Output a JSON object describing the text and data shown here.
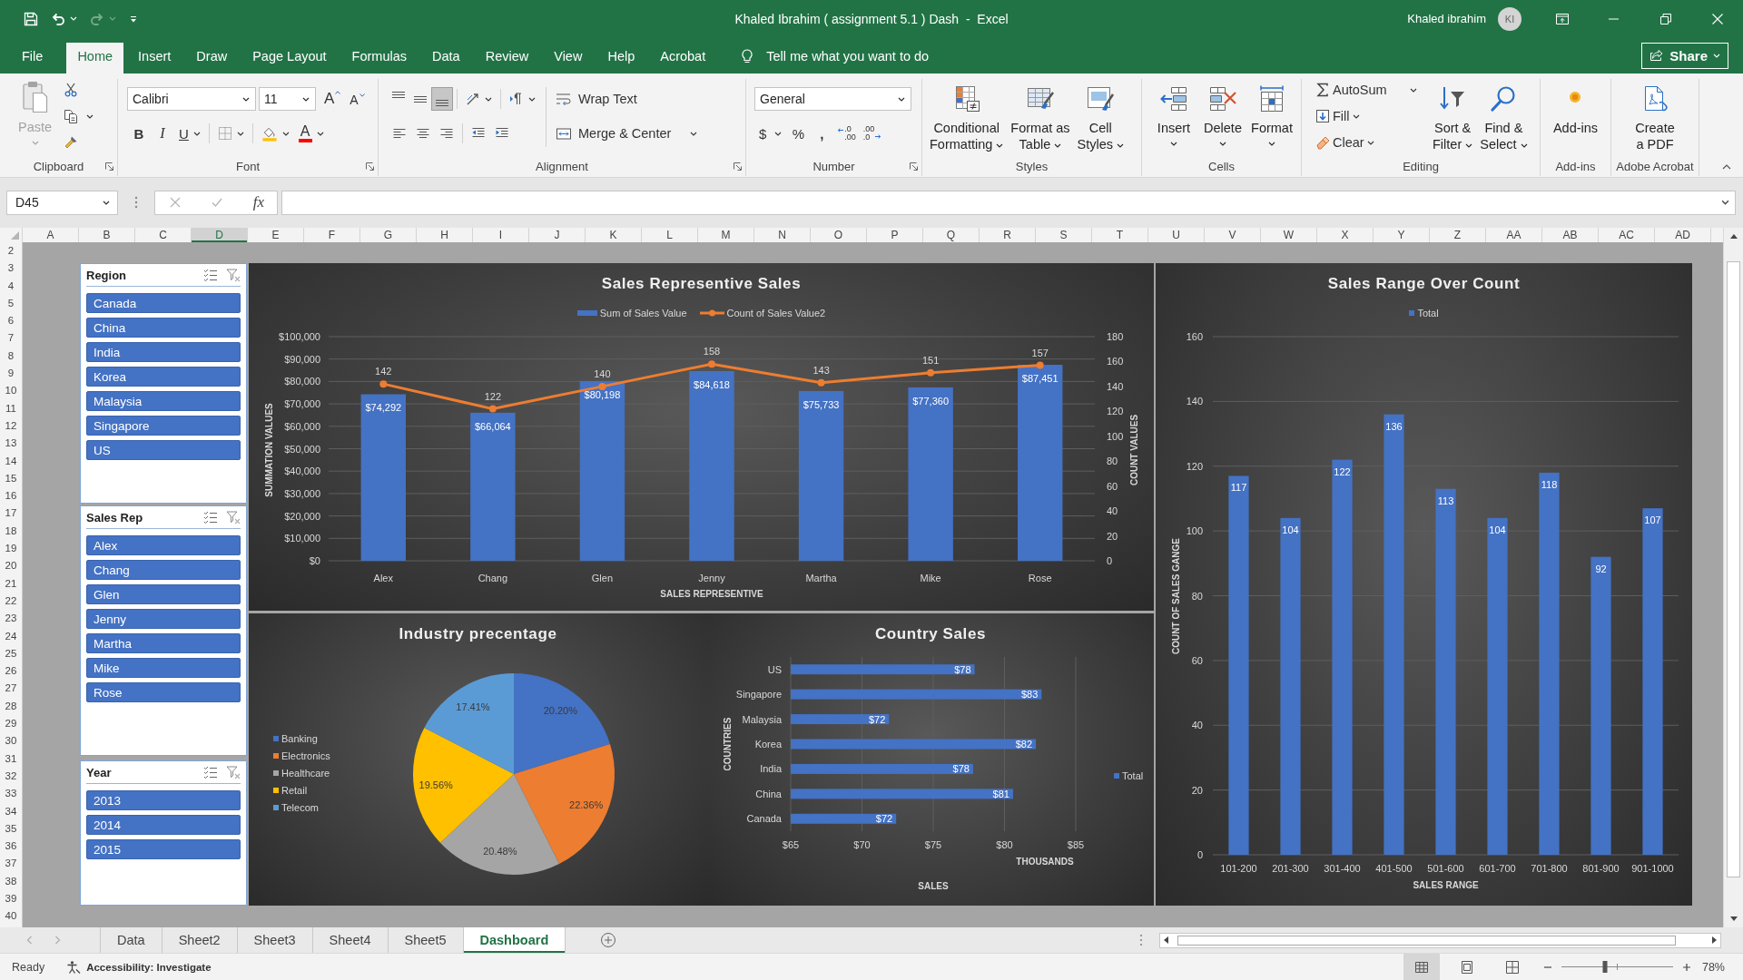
{
  "title_bar": {
    "title": "Khaled Ibrahim ( assignment 5.1 ) Dash  -  Excel",
    "user": "Khaled ibrahim",
    "initials": "KI",
    "redo_disabled": true
  },
  "menu_tabs": [
    {
      "label": "File",
      "selected": false
    },
    {
      "label": "Home",
      "selected": true
    },
    {
      "label": "Insert",
      "selected": false
    },
    {
      "label": "Draw",
      "selected": false
    },
    {
      "label": "Page Layout",
      "selected": false
    },
    {
      "label": "Formulas",
      "selected": false
    },
    {
      "label": "Data",
      "selected": false
    },
    {
      "label": "Review",
      "selected": false
    },
    {
      "label": "View",
      "selected": false
    },
    {
      "label": "Help",
      "selected": false
    },
    {
      "label": "Acrobat",
      "selected": false
    }
  ],
  "tell_me": "Tell me what you want to do",
  "share": "Share",
  "ribbon": {
    "clipboard": {
      "label": "Clipboard",
      "paste": "Paste",
      "paste_disabled": true
    },
    "font": {
      "label": "Font",
      "family": "Calibri",
      "size": "11",
      "grow": "A",
      "shrink": "A",
      "bold": "B",
      "italic": "I",
      "underline": "U",
      "color_letter": "A"
    },
    "alignment": {
      "label": "Alignment",
      "vertical": [
        {
          "kind": "top",
          "selected": false
        },
        {
          "kind": "middle",
          "selected": false
        },
        {
          "kind": "bottom",
          "selected": true
        }
      ],
      "wrap_text": "Wrap Text",
      "merge": "Merge & Center"
    },
    "number": {
      "label": "Number",
      "format": "General",
      "currency": "$",
      "percent": "%",
      "comma": ",",
      "increase_decimal": ".0\n.00",
      "decrease_decimal": ".00\n.0"
    },
    "styles": {
      "label": "Styles",
      "buttons": [
        {
          "kind": "conditional",
          "label": "Conditional\nFormatting"
        },
        {
          "kind": "table",
          "label": "Format as\nTable"
        },
        {
          "kind": "cell_styles",
          "label": "Cell\nStyles"
        }
      ]
    },
    "cells": {
      "label": "Cells",
      "buttons": [
        {
          "kind": "insert",
          "label": "Insert"
        },
        {
          "kind": "delete",
          "label": "Delete"
        },
        {
          "kind": "format",
          "label": "Format"
        }
      ]
    },
    "editing": {
      "label": "Editing",
      "autosum": "AutoSum",
      "fill": "Fill",
      "clear": "Clear",
      "sort": "Sort &\nFilter",
      "find": "Find &\nSelect"
    },
    "addins": {
      "label": "Add-ins",
      "button": "Add-ins"
    },
    "acrobat": {
      "label": "Adobe Acrobat",
      "button": "Create\na PDF"
    }
  },
  "formula_bar": {
    "name_box": "D45",
    "fx": "fx",
    "editing": false
  },
  "columns": [
    {
      "label": "A",
      "selected": false
    },
    {
      "label": "B",
      "selected": false
    },
    {
      "label": "C",
      "selected": false
    },
    {
      "label": "D",
      "selected": true
    },
    {
      "label": "E",
      "selected": false
    },
    {
      "label": "F",
      "selected": false
    },
    {
      "label": "G",
      "selected": false
    },
    {
      "label": "H",
      "selected": false
    },
    {
      "label": "I",
      "selected": false
    },
    {
      "label": "J",
      "selected": false
    },
    {
      "label": "K",
      "selected": false
    },
    {
      "label": "L",
      "selected": false
    },
    {
      "label": "M",
      "selected": false
    },
    {
      "label": "N",
      "selected": false
    },
    {
      "label": "O",
      "selected": false
    },
    {
      "label": "P",
      "selected": false
    },
    {
      "label": "Q",
      "selected": false
    },
    {
      "label": "R",
      "selected": false
    },
    {
      "label": "S",
      "selected": false
    },
    {
      "label": "T",
      "selected": false
    },
    {
      "label": "U",
      "selected": false
    },
    {
      "label": "V",
      "selected": false
    },
    {
      "label": "W",
      "selected": false
    },
    {
      "label": "X",
      "selected": false
    },
    {
      "label": "Y",
      "selected": false
    },
    {
      "label": "Z",
      "selected": false
    },
    {
      "label": "AA",
      "selected": false
    },
    {
      "label": "AB",
      "selected": false
    },
    {
      "label": "AC",
      "selected": false
    },
    {
      "label": "AD",
      "selected": false
    }
  ],
  "rows": [
    "2",
    "3",
    "4",
    "5",
    "6",
    "7",
    "8",
    "9",
    "10",
    "11",
    "12",
    "13",
    "14",
    "15",
    "16",
    "17",
    "18",
    "19",
    "20",
    "21",
    "22",
    "23",
    "24",
    "25",
    "26",
    "27",
    "28",
    "29",
    "30",
    "31",
    "32",
    "33",
    "34",
    "35",
    "36",
    "37",
    "38",
    "39",
    "40"
  ],
  "dashboard": {
    "slicers": [
      {
        "title": "Region",
        "filtered": false,
        "items": [
          {
            "label": "Canada",
            "selected": true
          },
          {
            "label": "China",
            "selected": true
          },
          {
            "label": "India",
            "selected": true
          },
          {
            "label": "Korea",
            "selected": true
          },
          {
            "label": "Malaysia",
            "selected": true
          },
          {
            "label": "Singapore",
            "selected": true
          },
          {
            "label": "US",
            "selected": true
          }
        ]
      },
      {
        "title": "Sales Rep",
        "filtered": false,
        "items": [
          {
            "label": "Alex",
            "selected": true
          },
          {
            "label": "Chang",
            "selected": true
          },
          {
            "label": "Glen",
            "selected": true
          },
          {
            "label": "Jenny",
            "selected": true
          },
          {
            "label": "Martha",
            "selected": true
          },
          {
            "label": "Mike",
            "selected": true
          },
          {
            "label": "Rose",
            "selected": true
          }
        ]
      },
      {
        "title": "Year",
        "filtered": false,
        "items": [
          {
            "label": "2013",
            "selected": true
          },
          {
            "label": "2014",
            "selected": true
          },
          {
            "label": "2015",
            "selected": true
          }
        ]
      }
    ],
    "charts": [
      {
        "chart_data": [
          {
            "type": "bar",
            "title": "Sales Representive Sales",
            "xlabel": "SALES REPRESENTIVE",
            "ylabel": "SUMMATION VALUES",
            "y2label": "COUNT VALUES",
            "legend": "top",
            "grid": true,
            "data_labels": true,
            "categories": [
              "Alex",
              "Chang",
              "Glen",
              "Jenny",
              "Martha",
              "Mike",
              "Rose"
            ],
            "series": [
              {
                "name": "Sum of Sales Value",
                "type": "bar",
                "color": "#4472c4",
                "values": [
                  74292,
                  66064,
                  80198,
                  84618,
                  75733,
                  77360,
                  87451
                ],
                "value_labels": [
                  "$74,292",
                  "$66,064",
                  "$80,198",
                  "$84,618",
                  "$75,733",
                  "$77,360",
                  "$87,451"
                ]
              },
              {
                "name": "Count of Sales Value2",
                "type": "line",
                "axis": "y2",
                "marker": "circle",
                "color": "#ed7d31",
                "values": [
                  142,
                  122,
                  140,
                  158,
                  143,
                  151,
                  157
                ],
                "value_labels": [
                  "142",
                  "122",
                  "140",
                  "158",
                  "143",
                  "151",
                  "157"
                ]
              }
            ],
            "ylim": [
              0,
              100000
            ],
            "y2lim": [
              0,
              180
            ],
            "yticks": [
              {
                "value": 0,
                "label": "$0"
              },
              {
                "value": 10000,
                "label": "$10,000"
              },
              {
                "value": 20000,
                "label": "$20,000"
              },
              {
                "value": 30000,
                "label": "$30,000"
              },
              {
                "value": 40000,
                "label": "$40,000"
              },
              {
                "value": 50000,
                "label": "$50,000"
              },
              {
                "value": 60000,
                "label": "$60,000"
              },
              {
                "value": 70000,
                "label": "$70,000"
              },
              {
                "value": 80000,
                "label": "$80,000"
              },
              {
                "value": 90000,
                "label": "$90,000"
              },
              {
                "value": 100000,
                "label": "$100,000"
              }
            ],
            "y2ticks": [
              0,
              20,
              40,
              60,
              80,
              100,
              120,
              140,
              160,
              180
            ]
          }
        ]
      },
      {
        "chart_data": [
          {
            "type": "bar",
            "title": "Sales Range Over Count",
            "xlabel": "SALES RANGE",
            "ylabel": "COUNT OF SALES GANGE",
            "legend": "top",
            "grid": true,
            "data_labels": true,
            "categories": [
              "101-200",
              "201-300",
              "301-400",
              "401-500",
              "501-600",
              "601-700",
              "701-800",
              "801-900",
              "901-1000"
            ],
            "series": [
              {
                "name": "Total",
                "color": "#4472c4",
                "values": [
                  117,
                  104,
                  122,
                  136,
                  113,
                  104,
                  118,
                  92,
                  107
                ]
              }
            ],
            "ylim": [
              0,
              160
            ],
            "yticks": [
              0,
              20,
              40,
              60,
              80,
              100,
              120,
              140,
              160
            ]
          }
        ]
      },
      {
        "chart_data": [
          {
            "type": "pie",
            "title": "Industry precentage",
            "legend": "left",
            "data_labels": true,
            "categories": [
              "Banking",
              "Electronics",
              "Healthcare",
              "Retail",
              "Telecom"
            ],
            "values": [
              20.2,
              22.36,
              20.48,
              19.56,
              17.41
            ],
            "colors": [
              "#4472c4",
              "#ed7d31",
              "#a5a5a5",
              "#ffc000",
              "#5b9bd5"
            ],
            "value_labels": [
              "20.20%",
              "22.36%",
              "20.48%",
              "19.56%",
              "17.41%"
            ]
          }
        ]
      },
      {
        "chart_data": [
          {
            "type": "bar",
            "orientation": "horizontal",
            "title": "Country Sales",
            "xlabel": "SALES",
            "ylabel": "COUNTRIES",
            "legend": "right",
            "grid": true,
            "data_labels": true,
            "categories": [
              "US",
              "Singapore",
              "Malaysia",
              "Korea",
              "India",
              "China",
              "Canada"
            ],
            "series": [
              {
                "name": "Total",
                "color": "#4472c4",
                "values": [
                  77.9,
                  82.6,
                  71.9,
                  82.2,
                  77.8,
                  80.6,
                  72.4
                ],
                "value_labels": [
                  "$78",
                  "$83",
                  "$72",
                  "$82",
                  "$78",
                  "$81",
                  "$72"
                ]
              }
            ],
            "xlim": [
              65,
              85
            ],
            "xticks": [
              {
                "value": 65,
                "label": "$65"
              },
              {
                "value": 70,
                "label": "$70"
              },
              {
                "value": 75,
                "label": "$75"
              },
              {
                "value": 80,
                "label": "$80"
              },
              {
                "value": 85,
                "label": "$85"
              }
            ],
            "annotations": [
              "THOUSANDS"
            ]
          }
        ]
      }
    ]
  },
  "sheet_tabs": [
    {
      "label": "Data",
      "selected": false
    },
    {
      "label": "Sheet2",
      "selected": false
    },
    {
      "label": "Sheet3",
      "selected": false
    },
    {
      "label": "Sheet4",
      "selected": false
    },
    {
      "label": "Sheet5",
      "selected": false
    },
    {
      "label": "Dashboard",
      "selected": true
    }
  ],
  "status_bar": {
    "ready": "Ready",
    "accessibility": "Accessibility: Investigate",
    "views": [
      {
        "kind": "normal",
        "selected": true
      },
      {
        "kind": "page_layout",
        "selected": false
      },
      {
        "kind": "page_break",
        "selected": false
      }
    ],
    "zoom": {
      "level": 0.39,
      "reading": "78%"
    }
  }
}
